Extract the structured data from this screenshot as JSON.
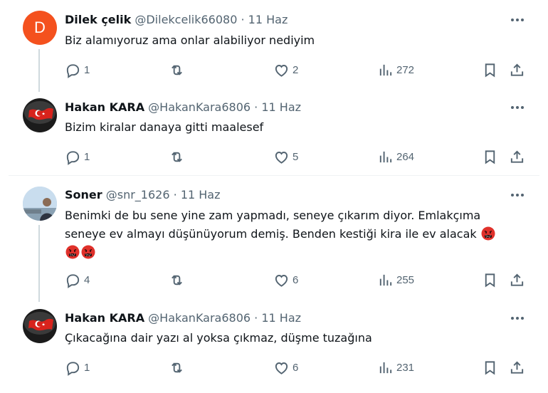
{
  "tweets": [
    {
      "name": "Dilek çelik",
      "handle": "@Dilekcelik66080",
      "sep": "·",
      "date": "11 Haz",
      "avatar_letter": "D",
      "text": "Biz alamıyoruz ama onlar alabiliyor nediyim",
      "replies": "1",
      "retweets": "",
      "likes": "2",
      "views": "272"
    },
    {
      "name": "Hakan KARA",
      "handle": "@HakanKara6806",
      "sep": "·",
      "date": "11 Haz",
      "text": "Bizim kiralar danaya gitti maalesef",
      "replies": "1",
      "retweets": "",
      "likes": "5",
      "views": "264"
    },
    {
      "name": "Soner",
      "handle": "@snr_1626",
      "sep": "·",
      "date": "11 Haz",
      "text_line1": "Benimki de bu sene yine zam yapmadı, seneye çıkarım diyor. Emlakçıma",
      "text_line2": "seneye ev almayı düşünüyorum demiş. Benden kestiği kira ile ev alacak",
      "replies": "4",
      "retweets": "",
      "likes": "6",
      "views": "255"
    },
    {
      "name": "Hakan KARA",
      "handle": "@HakanKara6806",
      "sep": "·",
      "date": "11 Haz",
      "text": "Çıkacağına dair yazı al yoksa çıkmaz, düşme tuzağına",
      "replies": "1",
      "retweets": "",
      "likes": "6",
      "views": "231"
    }
  ],
  "icons": [
    "comment-icon",
    "retweet-icon",
    "like-icon",
    "views-icon",
    "bookmark-icon",
    "share-icon",
    "more-icon",
    "angry-emoji-icon"
  ],
  "colors": {
    "text": "#0f1419",
    "secondary": "#536471",
    "divider": "#eff3f4",
    "thread_line": "#cfd9de",
    "avatar_d": "#f4511e"
  }
}
